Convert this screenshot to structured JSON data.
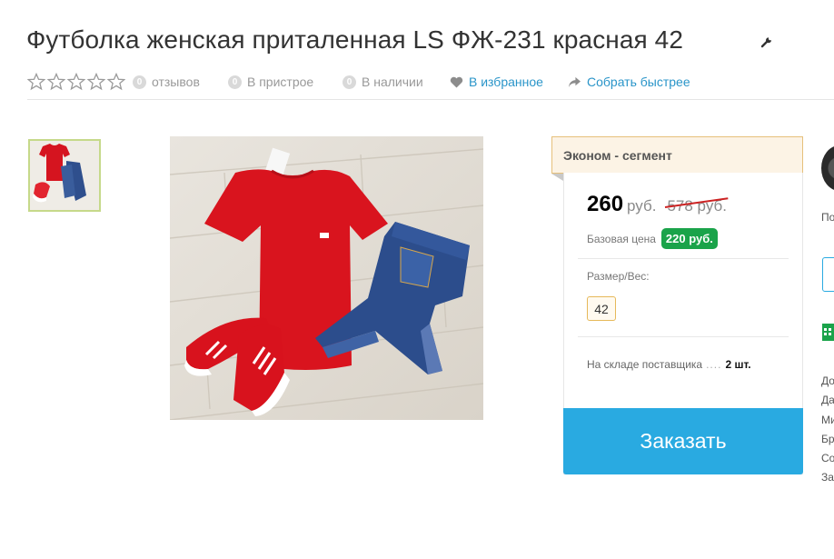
{
  "product": {
    "title": "Футболка женская приталенная LS ФЖ-231 красная 42"
  },
  "meta": {
    "reviews_count": "0",
    "reviews_label": "отзывов",
    "in_build_count": "0",
    "in_build_label": "В пристрое",
    "in_stock_count": "0",
    "in_stock_label": "В наличии",
    "favorites_label": "В избранное",
    "quick_collect_label": "Собрать быстрее"
  },
  "offer": {
    "segment_label": "Эконом - сегмент",
    "price": "260",
    "currency": "руб.",
    "old_price": "578 руб.",
    "base_price_label": "Базовая цена",
    "base_price_value": "220 руб.",
    "size_label": "Размер/Вес:",
    "size_value": "42",
    "stock_label": "На складе поставщика",
    "stock_dots": "....",
    "stock_qty": "2 шт.",
    "order_button": "Заказать"
  },
  "right_column": {
    "line1": "По",
    "lines": [
      "До",
      "Да",
      "Ми",
      "Бр",
      "Со",
      "За"
    ]
  },
  "colors": {
    "accent": "#29aae1",
    "link": "#2a95c9",
    "base_badge": "#1aa34a",
    "strike": "#cc2222",
    "segment_bg": "#fcf3e5"
  },
  "icons": {
    "rating": "star-outline-icon",
    "edit": "wrench-icon",
    "favorite": "heart-icon",
    "share": "share-arrow-icon",
    "calendar": "calendar-icon"
  }
}
